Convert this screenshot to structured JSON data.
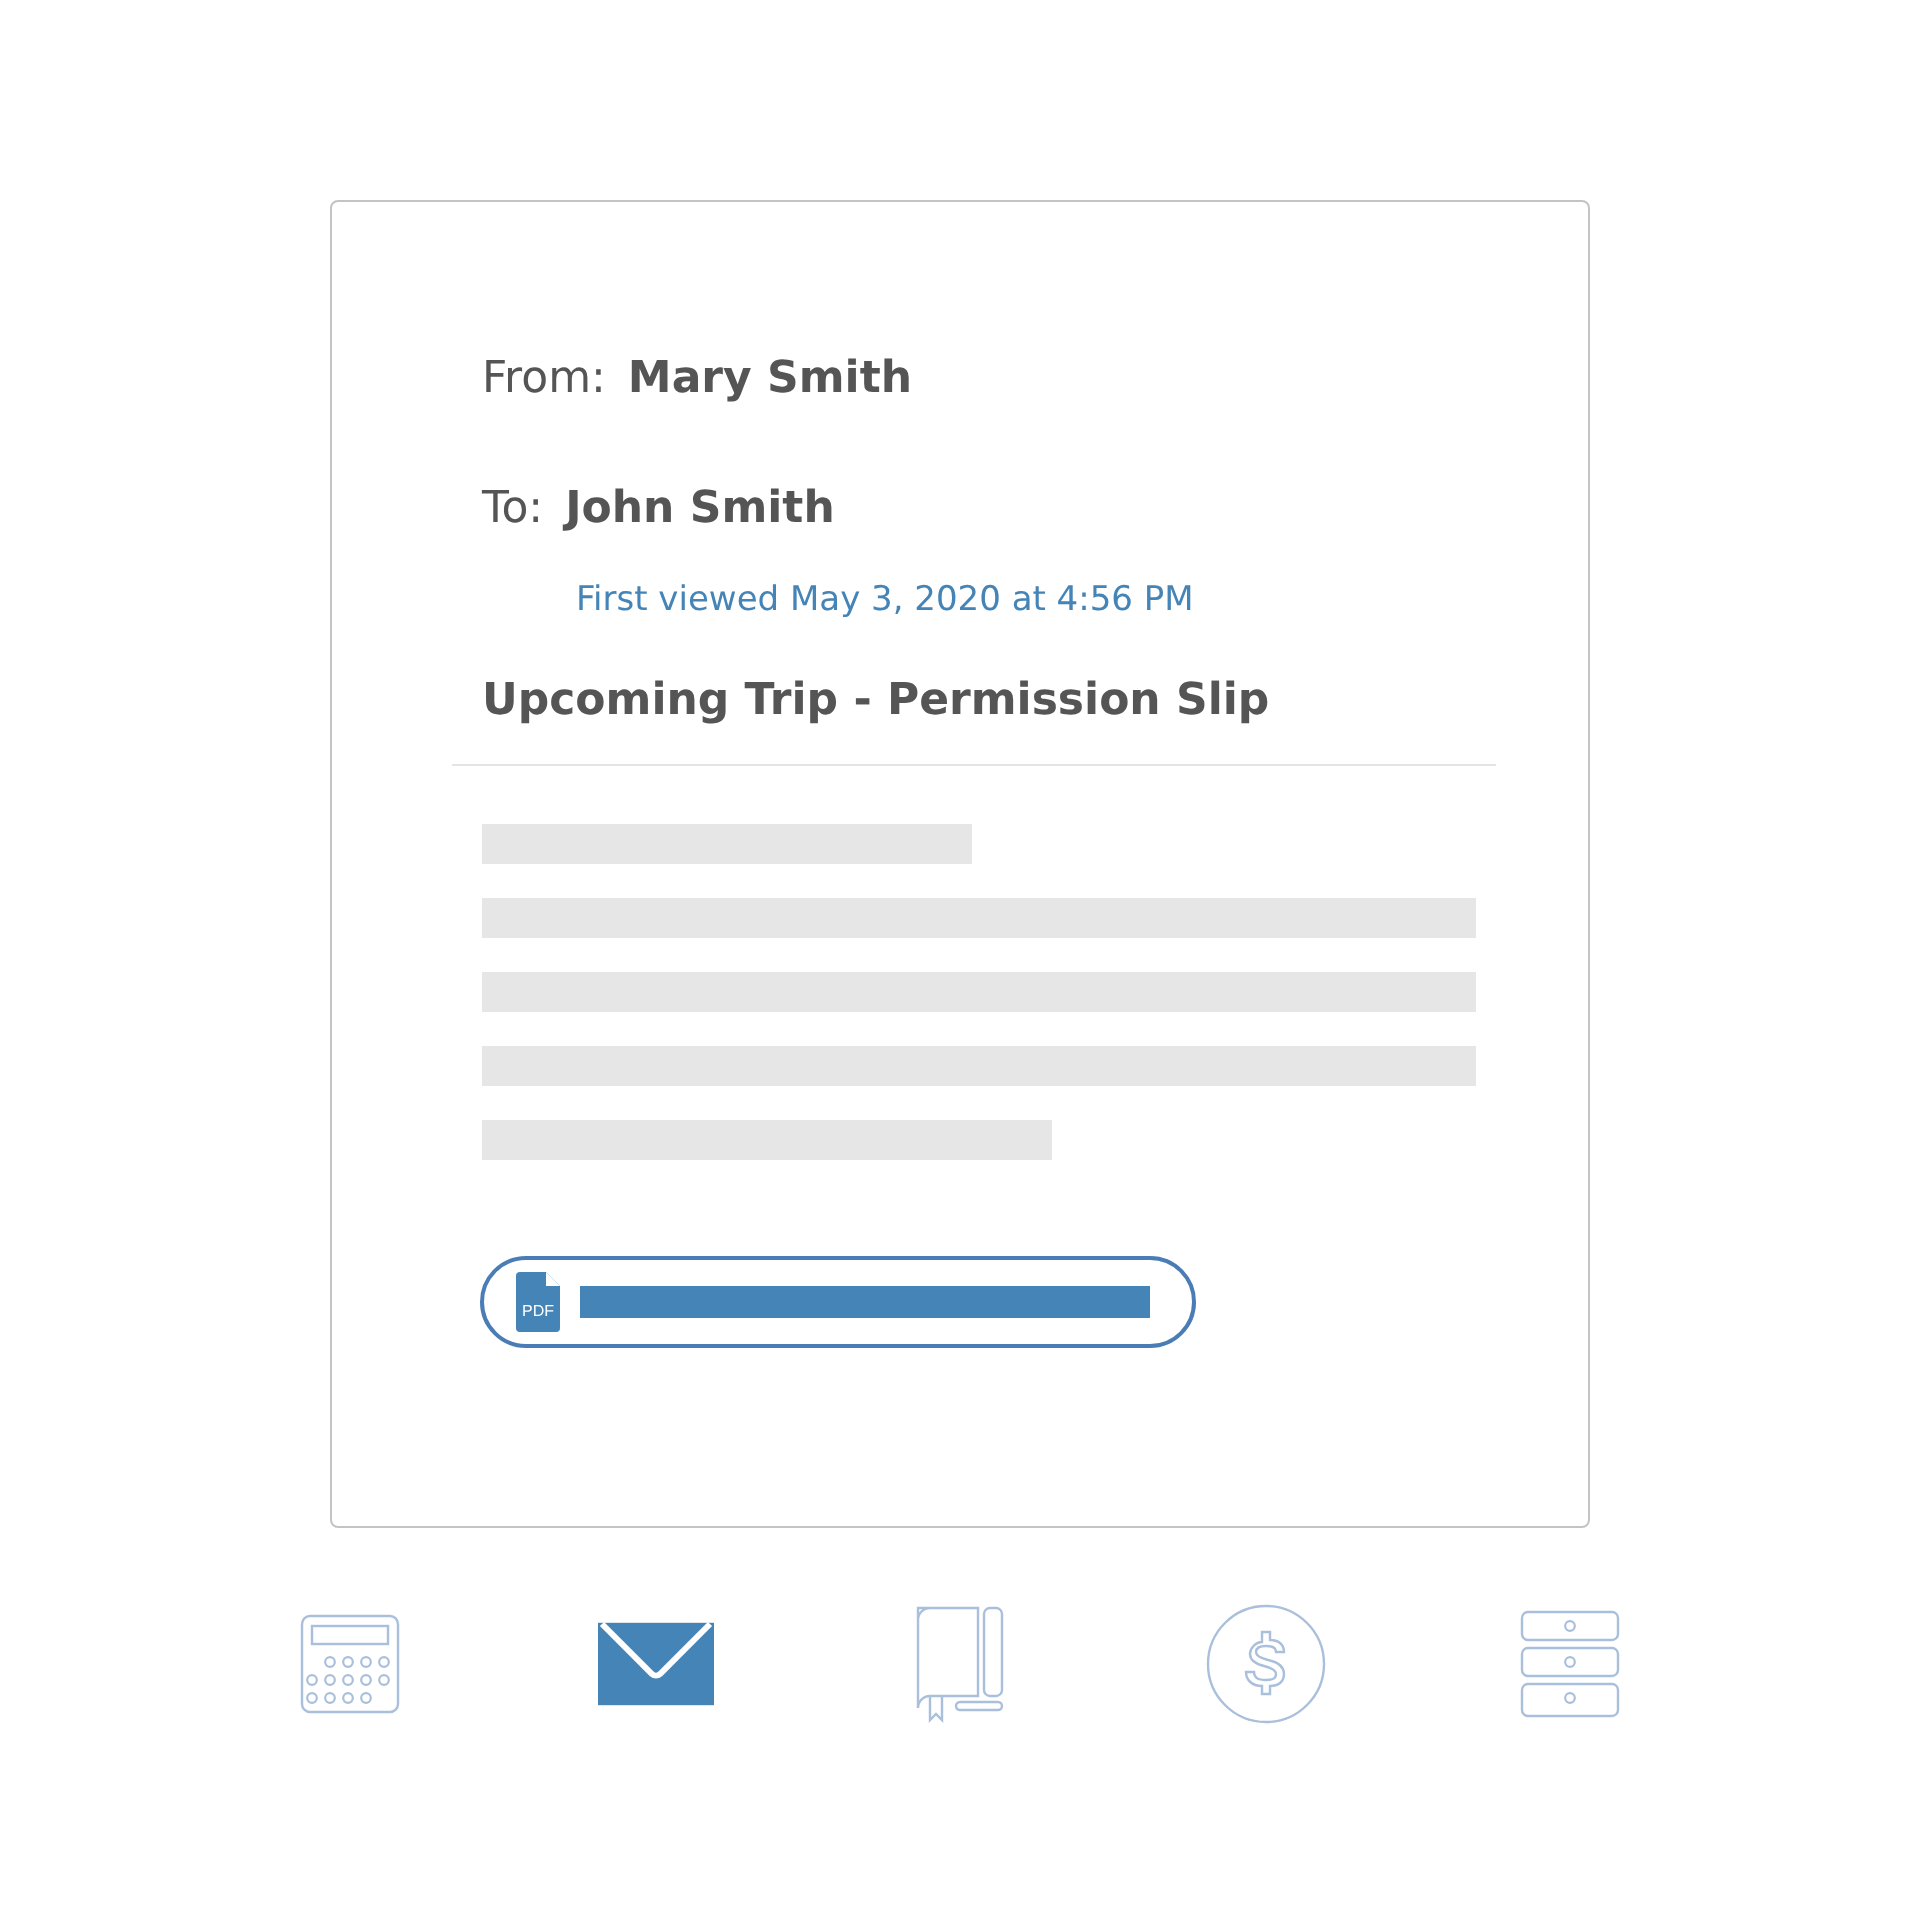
{
  "message": {
    "from_label": "From:",
    "from": "Mary Smith",
    "to_label": "To:",
    "to": "John Smith",
    "viewed": "First viewed May 3, 2020 at 4:56 PM",
    "subject": "Upcoming Trip - Permission Slip"
  },
  "attachment": {
    "kind": "pdf",
    "icon_text": "PDF"
  },
  "nav": [
    {
      "kind": "calculator",
      "selected": false
    },
    {
      "kind": "mail",
      "selected": true
    },
    {
      "kind": "book",
      "selected": false
    },
    {
      "kind": "dollar",
      "selected": false
    },
    {
      "kind": "cabinet",
      "selected": false
    }
  ]
}
